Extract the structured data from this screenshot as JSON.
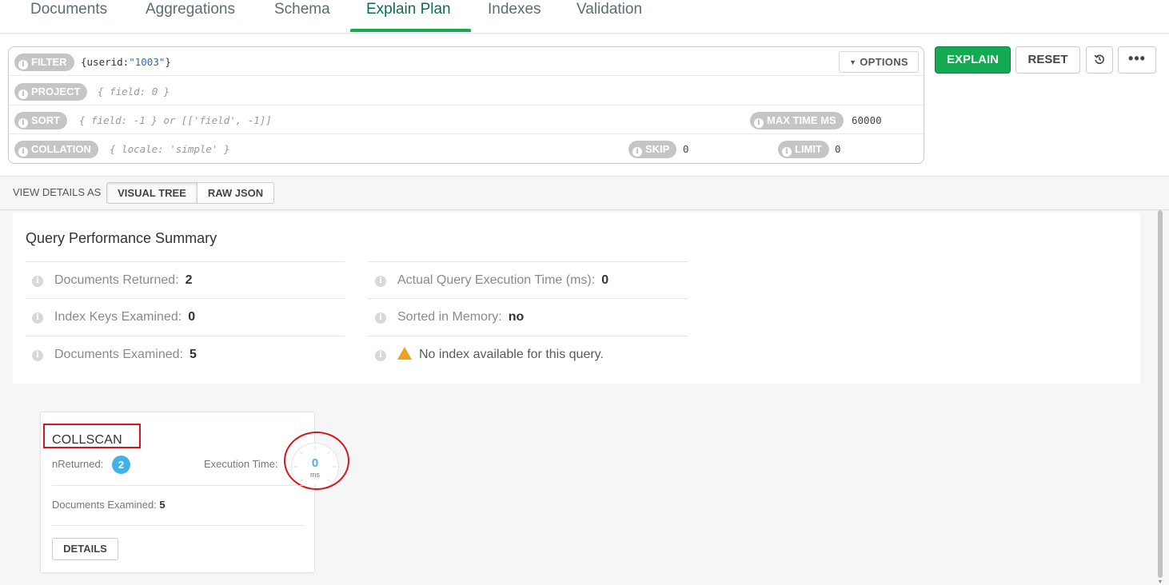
{
  "tabs": [
    {
      "label": "Documents"
    },
    {
      "label": "Aggregations"
    },
    {
      "label": "Schema"
    },
    {
      "label": "Explain Plan"
    },
    {
      "label": "Indexes"
    },
    {
      "label": "Validation"
    }
  ],
  "active_tab": "Explain Plan",
  "query": {
    "filter_label": "FILTER",
    "filter_prefix": "{userid:",
    "filter_value": "\"1003\"",
    "filter_suffix": "}",
    "options_label": "OPTIONS",
    "project_label": "PROJECT",
    "project_placeholder": "{ field: 0 }",
    "sort_label": "SORT",
    "sort_placeholder": "{ field: -1 } or [['field', -1]]",
    "max_time_label": "MAX TIME MS",
    "max_time_value": "60000",
    "collation_label": "COLLATION",
    "collation_placeholder": "{ locale: 'simple' }",
    "skip_label": "SKIP",
    "skip_value": "0",
    "limit_label": "LIMIT",
    "limit_value": "0"
  },
  "actions": {
    "explain_label": "EXPLAIN",
    "reset_label": "RESET",
    "history_icon": "history-icon",
    "more_label": "•••"
  },
  "view": {
    "label": "VIEW DETAILS AS",
    "visual_tree": "VISUAL TREE",
    "raw_json": "RAW JSON",
    "selected": "VISUAL TREE"
  },
  "summary": {
    "title": "Query Performance Summary",
    "left": [
      {
        "label": "Documents Returned:",
        "value": "2"
      },
      {
        "label": "Index Keys Examined:",
        "value": "0"
      },
      {
        "label": "Documents Examined:",
        "value": "5"
      }
    ],
    "right": [
      {
        "label": "Actual Query Execution Time (ms):",
        "value": "0"
      },
      {
        "label": "Sorted in Memory:",
        "value": "no"
      }
    ],
    "warning": "No index available for this query."
  },
  "stage": {
    "name": "COLLSCAN",
    "n_returned_label": "nReturned:",
    "n_returned": "2",
    "exec_time_label": "Execution Time:",
    "exec_time_value": "0",
    "exec_time_unit": "ms",
    "docs_examined_label": "Documents Examined:",
    "docs_examined": "5",
    "details_label": "DETAILS"
  },
  "colors": {
    "accent_green": "#13aa52",
    "active_tab_text": "#0d6b55",
    "badge_blue": "#43b1e5",
    "annotation_red": "#d6151b",
    "warning_orange": "#f0a020"
  }
}
